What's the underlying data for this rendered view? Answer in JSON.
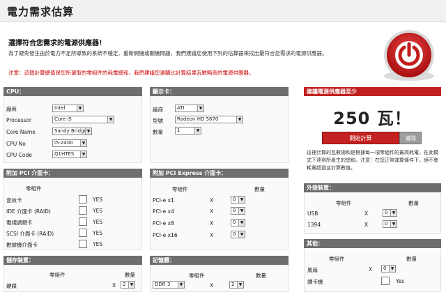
{
  "page": {
    "title": "電力需求估算"
  },
  "intro": {
    "heading": "選擇符合您需求的電源供應器！",
    "text": "為了避免發生由於電力不足所導致的系統不穩定、重新開機或關機問題，我們建議您使用下列的估算器來找出最符合您需求的電源供應器。",
    "note": "注意：這個計算總值是您所選取的零組件的耗電總和，我們建議您選購比計算結果瓦數略高的電源供應器。"
  },
  "cpu": {
    "header": "CPU：",
    "labels": {
      "brand": "廠商",
      "processor": "Processor",
      "core_name": "Core Name",
      "cpu_no": "CPU No",
      "cpu_code": "CPU Code"
    },
    "values": {
      "brand": "Intel",
      "processor": "Core i5",
      "core_name": "Sandy Bridge",
      "cpu_no": "i5-2400",
      "cpu_code": "Q1HTES"
    }
  },
  "display": {
    "header": "顯示卡：",
    "labels": {
      "brand": "廠商",
      "model": "型號",
      "qty": "數量"
    },
    "values": {
      "brand": "ATI",
      "model": "Radeon HD 5670",
      "qty": "1"
    }
  },
  "pci": {
    "header": "附加 PCI 介面卡：",
    "col_component": "零組件",
    "items": [
      {
        "label": "音效卡",
        "value": "YES"
      },
      {
        "label": "IDE 介面卡 (RAID)",
        "value": "YES"
      },
      {
        "label": "電視調頻卡",
        "value": "YES"
      },
      {
        "label": "SCSI 介面卡 (RAID)",
        "value": "YES"
      },
      {
        "label": "數據機介面卡",
        "value": "YES"
      }
    ]
  },
  "pcie": {
    "header": "附加 PCI Express 介面卡：",
    "col_component": "零組件",
    "col_qty": "數量",
    "x": "X",
    "items": [
      {
        "label": "PCI-e x1",
        "qty": "0"
      },
      {
        "label": "PCI-e x4",
        "qty": "0"
      },
      {
        "label": "PCI-e x8",
        "qty": "0"
      },
      {
        "label": "PCI-e x16",
        "qty": "0"
      }
    ]
  },
  "storage": {
    "header": "儲存裝置：",
    "col_component": "零組件",
    "col_qty": "數量",
    "x": "X",
    "items": [
      {
        "label": "硬碟",
        "qty": "2"
      }
    ]
  },
  "memory": {
    "header": "記憶體：",
    "col_component": "零組件",
    "col_qty": "數量",
    "x": "X",
    "items": [
      {
        "type": "DDR 3",
        "qty": "2"
      }
    ]
  },
  "recommend": {
    "header": "建議電源供應器至少",
    "value": "250 瓦！",
    "start_label": "開始計算",
    "clear_label": "清除",
    "desc": "這裡計算的瓦數總和是根據每一項零組件的最高耗電，在此模式下達到所產生的總和。注意：在您正常運算條件下，絕不會耗電超過這計算數值。"
  },
  "external": {
    "header": "外接裝置：",
    "col_component": "零組件",
    "col_qty": "數量",
    "x": "X",
    "items": [
      {
        "label": "USB",
        "qty": "0"
      },
      {
        "label": "1394",
        "qty": "0"
      }
    ]
  },
  "other": {
    "header": "其他：",
    "col_component": "零組件",
    "col_qty": "數量",
    "x": "X",
    "items": [
      {
        "label": "風扇",
        "qty": "0"
      },
      {
        "label": "讀卡機",
        "value": "Yes"
      }
    ]
  },
  "colors": {
    "accent": "#c02020",
    "panel_header": "#6e6e6e"
  },
  "icons": {
    "logo": "power-button-icon",
    "dropdown": "chevron-down-icon"
  }
}
